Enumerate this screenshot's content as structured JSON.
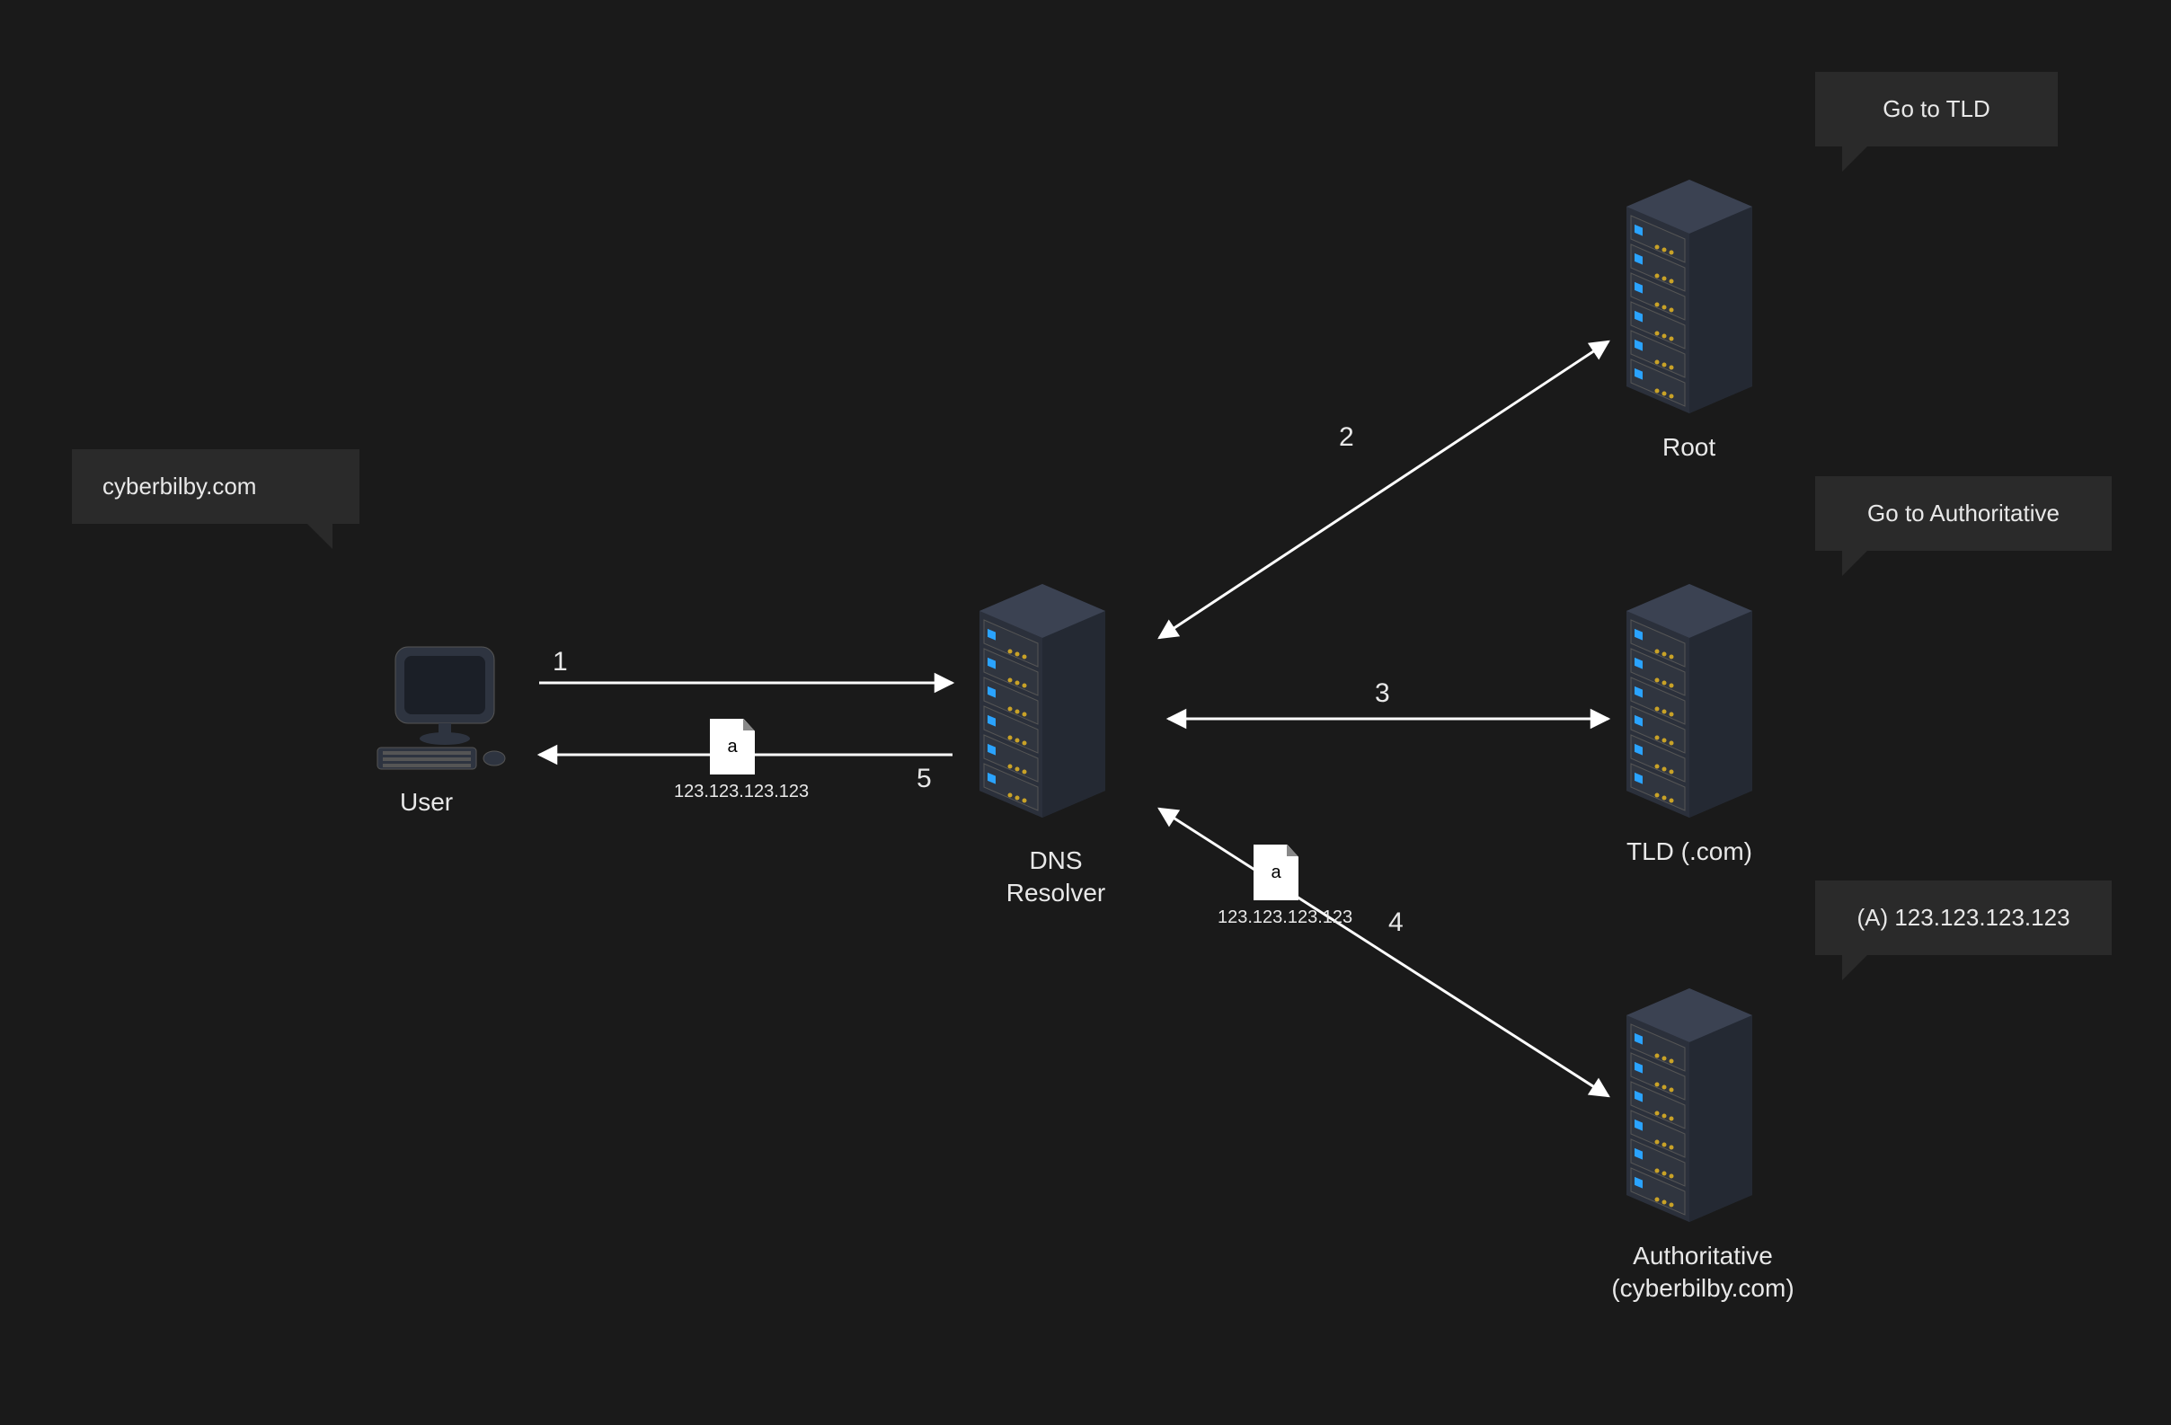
{
  "nodes": {
    "user": {
      "label": "User"
    },
    "resolver": {
      "label_line1": "DNS",
      "label_line2": "Resolver"
    },
    "root": {
      "label": "Root"
    },
    "tld": {
      "label": "TLD (.com)"
    },
    "auth": {
      "label_line1": "Authoritative",
      "label_line2": "(cyberbilby.com)"
    }
  },
  "bubbles": {
    "user": "cyberbilby.com",
    "root": "Go to TLD",
    "tld": "Go to Authoritative",
    "auth": "(A) 123.123.123.123"
  },
  "steps": {
    "s1": "1",
    "s2": "2",
    "s3": "3",
    "s4": "4",
    "s5": "5"
  },
  "docs": {
    "auth_to_resolver": {
      "letter": "a",
      "ip": "123.123.123.123"
    },
    "resolver_to_user": {
      "letter": "a",
      "ip": "123.123.123.123"
    }
  }
}
